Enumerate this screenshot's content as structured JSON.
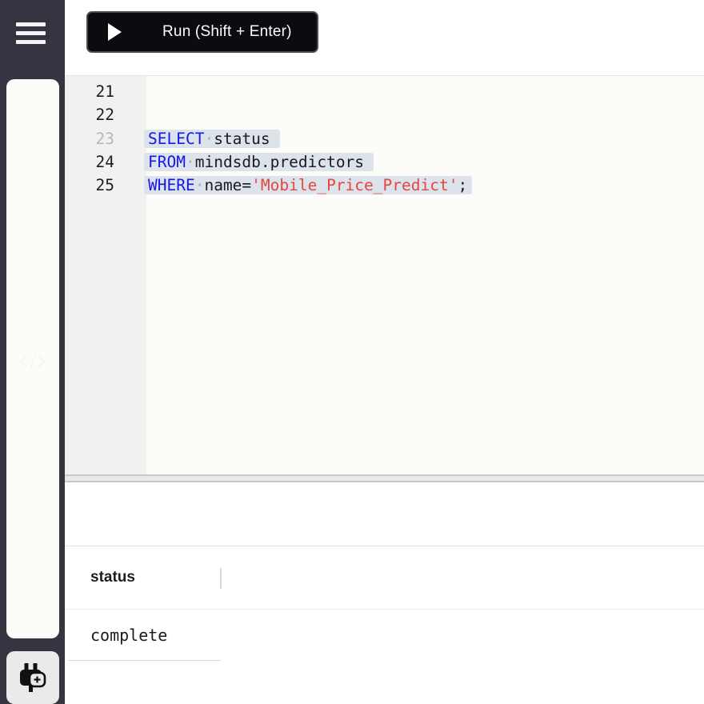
{
  "sidebar": {
    "items": [
      {
        "id": "menu",
        "icon": "hamburger-menu-icon"
      },
      {
        "id": "editor",
        "icon": "code-icon",
        "selected": false
      },
      {
        "id": "add-connection",
        "icon": "plug-add-icon",
        "selected": true
      }
    ]
  },
  "toolbar": {
    "run_label": "Run (Shift + Enter)",
    "run_icon": "play-icon"
  },
  "editor": {
    "lines": [
      {
        "num": "21",
        "segments": []
      },
      {
        "num": "22",
        "segments": []
      },
      {
        "num": "23",
        "num_muted": true,
        "selected": true,
        "trailing_newline": true,
        "segments": [
          {
            "type": "keyword",
            "text": "SELECT"
          },
          {
            "type": "ws",
            "text": "·"
          },
          {
            "type": "plain",
            "text": "status"
          }
        ]
      },
      {
        "num": "24",
        "selected": true,
        "trailing_newline": true,
        "segments": [
          {
            "type": "keyword",
            "text": "FROM"
          },
          {
            "type": "ws",
            "text": "·"
          },
          {
            "type": "plain",
            "text": "mindsdb.predictors"
          }
        ]
      },
      {
        "num": "25",
        "selected": true,
        "trailing_newline": false,
        "segments": [
          {
            "type": "keyword",
            "text": "WHERE"
          },
          {
            "type": "ws",
            "text": "·"
          },
          {
            "type": "plain",
            "text": "name="
          },
          {
            "type": "string",
            "text": "'Mobile_Price_Predict'"
          },
          {
            "type": "plain",
            "text": ";"
          }
        ]
      }
    ]
  },
  "results": {
    "columns": [
      "status"
    ],
    "rows": [
      [
        "complete"
      ]
    ]
  },
  "colors": {
    "sidebar_bg": "#353440",
    "icon_selected_bg": "#eaeaea",
    "run_btn_bg": "#0b0b10",
    "editor_bg": "#fcfcf8",
    "gutter_bg": "#f1f1ef",
    "selection_bg": "#dce3eb",
    "keyword": "#1616ee",
    "string": "#e5463d",
    "code_fg": "#1b1b1d",
    "line_num_muted": "#b8b8ba"
  }
}
